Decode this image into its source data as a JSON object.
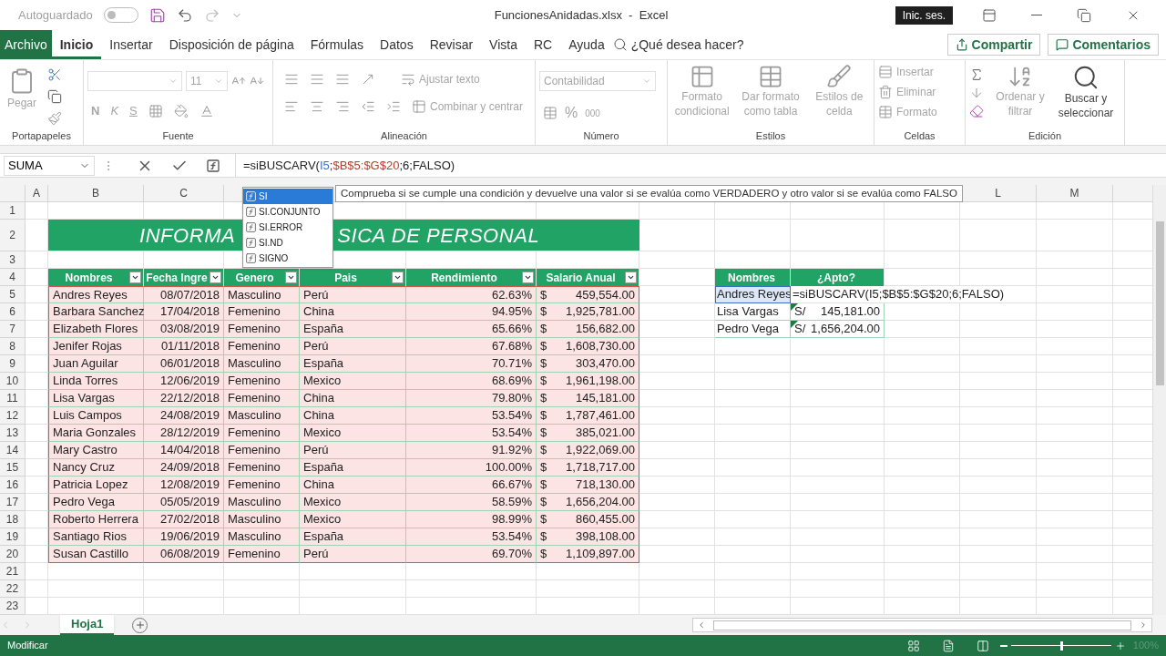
{
  "title_bar": {
    "autosave_label": "Autoguardado",
    "autosave_on": false,
    "title": "FuncionesAnidadas.xlsx  -  Excel",
    "sign_in": "Inic. ses."
  },
  "menu_tabs": [
    {
      "label": "Archivo",
      "kind": "file",
      "selected": false
    },
    {
      "label": "Inicio",
      "kind": "tab",
      "selected": true
    },
    {
      "label": "Insertar",
      "kind": "tab",
      "selected": false
    },
    {
      "label": "Disposición de página",
      "kind": "tab",
      "selected": false
    },
    {
      "label": "Fórmulas",
      "kind": "tab",
      "selected": false
    },
    {
      "label": "Datos",
      "kind": "tab",
      "selected": false
    },
    {
      "label": "Revisar",
      "kind": "tab",
      "selected": false
    },
    {
      "label": "Vista",
      "kind": "tab",
      "selected": false
    },
    {
      "label": "RC",
      "kind": "tab",
      "selected": false
    },
    {
      "label": "Ayuda",
      "kind": "tab",
      "selected": false
    }
  ],
  "tell_me": "¿Qué desea hacer?",
  "share": "Compartir",
  "comments": "Comentarios",
  "ribbon": {
    "clipboard": {
      "label": "Portapapeles",
      "paste": "Pegar"
    },
    "font": {
      "label": "Fuente",
      "size": "11",
      "bold": "N",
      "italic": "K",
      "underline": "S"
    },
    "alignment": {
      "label": "Alineación",
      "wrap": "Ajustar texto",
      "merge": "Combinar y centrar"
    },
    "number": {
      "label": "Número",
      "format": "Contabilidad",
      "percent": "%",
      "thousands": "000"
    },
    "styles": {
      "label": "Estilos",
      "buttons": [
        "Formato condicional",
        "Dar formato como tabla",
        "Estilos de celda"
      ]
    },
    "cells": {
      "label": "Celdas",
      "buttons": [
        "Insertar",
        "Eliminar",
        "Formato"
      ]
    },
    "editing": {
      "label": "Edición",
      "buttons": [
        "Ordenar y filtrar",
        "Buscar y seleccionar"
      ]
    }
  },
  "formula_bar": {
    "name_box": "SUMA",
    "formula": [
      {
        "text": "=siBUSCARV(",
        "kind": "plain"
      },
      {
        "text": "I5",
        "kind": "ref",
        "color": "#3b6fc9"
      },
      {
        "text": ";",
        "kind": "plain"
      },
      {
        "text": "$B$5:$G$20",
        "kind": "ref",
        "color": "#c0392b"
      },
      {
        "text": ";6;FALSO)",
        "kind": "plain"
      }
    ]
  },
  "sheet": {
    "columns_left": [
      "A",
      "B",
      "C"
    ],
    "columns_right": [
      "L",
      "M"
    ],
    "row_numbers": [
      "1",
      "2",
      "3",
      "4",
      "5",
      "6",
      "7",
      "8",
      "9",
      "10",
      "11",
      "12",
      "13",
      "14",
      "15",
      "16",
      "17",
      "18",
      "19",
      "20",
      "21",
      "22",
      "23"
    ],
    "banner": {
      "left": "INFORMA",
      "right": "SICA DE PERSONAL"
    },
    "table_headers": [
      "Nombres",
      "Fecha Ingre",
      "Genero",
      "Pais",
      "Rendimiento",
      "Salario Anual"
    ],
    "rows": [
      {
        "name": "Andres Reyes",
        "date": "08/07/2018",
        "gender": "Masculino",
        "country": "Perú",
        "performance": "62.63%",
        "currency": "$",
        "salary": "459,554.00"
      },
      {
        "name": "Barbara Sanchez",
        "date": "17/04/2018",
        "gender": "Femenino",
        "country": "China",
        "performance": "94.95%",
        "currency": "$",
        "salary": "1,925,781.00"
      },
      {
        "name": "Elizabeth Flores",
        "date": "03/08/2019",
        "gender": "Femenino",
        "country": "España",
        "performance": "65.66%",
        "currency": "$",
        "salary": "156,682.00"
      },
      {
        "name": "Jenifer Rojas",
        "date": "01/11/2018",
        "gender": "Femenino",
        "country": "Perú",
        "performance": "67.68%",
        "currency": "$",
        "salary": "1,608,730.00"
      },
      {
        "name": "Juan Aguilar",
        "date": "06/01/2018",
        "gender": "Masculino",
        "country": "España",
        "performance": "70.71%",
        "currency": "$",
        "salary": "303,470.00"
      },
      {
        "name": "Linda Torres",
        "date": "12/06/2019",
        "gender": "Femenino",
        "country": "Mexico",
        "performance": "68.69%",
        "currency": "$",
        "salary": "1,961,198.00"
      },
      {
        "name": "Lisa Vargas",
        "date": "22/12/2018",
        "gender": "Femenino",
        "country": "China",
        "performance": "79.80%",
        "currency": "$",
        "salary": "145,181.00"
      },
      {
        "name": "Luis Campos",
        "date": "24/08/2019",
        "gender": "Masculino",
        "country": "China",
        "performance": "53.54%",
        "currency": "$",
        "salary": "1,787,461.00"
      },
      {
        "name": "Maria Gonzales",
        "date": "28/12/2019",
        "gender": "Femenino",
        "country": "Mexico",
        "performance": "53.54%",
        "currency": "$",
        "salary": "385,021.00"
      },
      {
        "name": "Mary Castro",
        "date": "14/04/2018",
        "gender": "Femenino",
        "country": "Perú",
        "performance": "91.92%",
        "currency": "$",
        "salary": "1,922,069.00"
      },
      {
        "name": "Nancy Cruz",
        "date": "24/09/2018",
        "gender": "Femenino",
        "country": "España",
        "performance": "100.00%",
        "currency": "$",
        "salary": "1,718,717.00"
      },
      {
        "name": "Patricia Lopez",
        "date": "12/08/2019",
        "gender": "Femenino",
        "country": "China",
        "performance": "66.67%",
        "currency": "$",
        "salary": "718,130.00"
      },
      {
        "name": "Pedro Vega",
        "date": "05/05/2019",
        "gender": "Masculino",
        "country": "Mexico",
        "performance": "58.59%",
        "currency": "$",
        "salary": "1,656,204.00"
      },
      {
        "name": "Roberto Herrera",
        "date": "27/02/2018",
        "gender": "Masculino",
        "country": "Mexico",
        "performance": "98.99%",
        "currency": "$",
        "salary": "860,455.00"
      },
      {
        "name": "Santiago Rios",
        "date": "19/06/2019",
        "gender": "Masculino",
        "country": "España",
        "performance": "53.54%",
        "currency": "$",
        "salary": "398,108.00"
      },
      {
        "name": "Susan Castillo",
        "date": "06/08/2019",
        "gender": "Femenino",
        "country": "Perú",
        "performance": "69.70%",
        "currency": "$",
        "salary": "1,109,897.00"
      }
    ],
    "lookup_headers": [
      "Nombres",
      "¿Apto?"
    ],
    "lookup_rows": [
      {
        "name": "Andres Reyes",
        "editing": true,
        "value": "=siBUSCARV(I5;$B$5:$G$20;6;FALSO)"
      },
      {
        "name": "Lisa Vargas",
        "editing": false,
        "currency": "S/",
        "value": "145,181.00",
        "flagged": true
      },
      {
        "name": "Pedro Vega",
        "editing": false,
        "currency": "S/",
        "value": "1,656,204.00",
        "flagged": true
      }
    ]
  },
  "autocomplete": {
    "items": [
      {
        "label": "SI",
        "selected": true
      },
      {
        "label": "SI.CONJUNTO",
        "selected": false
      },
      {
        "label": "SI.ERROR",
        "selected": false
      },
      {
        "label": "SI.ND",
        "selected": false
      },
      {
        "label": "SIGNO",
        "selected": false
      }
    ],
    "tooltip": "Comprueba si se cumple una condición y devuelve una valor si se evalúa como VERDADERO y otro valor si se evalúa como FALSO"
  },
  "sheet_tabs": [
    {
      "label": "Hoja1",
      "selected": true
    }
  ],
  "status_bar": {
    "mode": "Modificar",
    "zoom": {
      "level": 0.5,
      "reading": "100%"
    }
  }
}
